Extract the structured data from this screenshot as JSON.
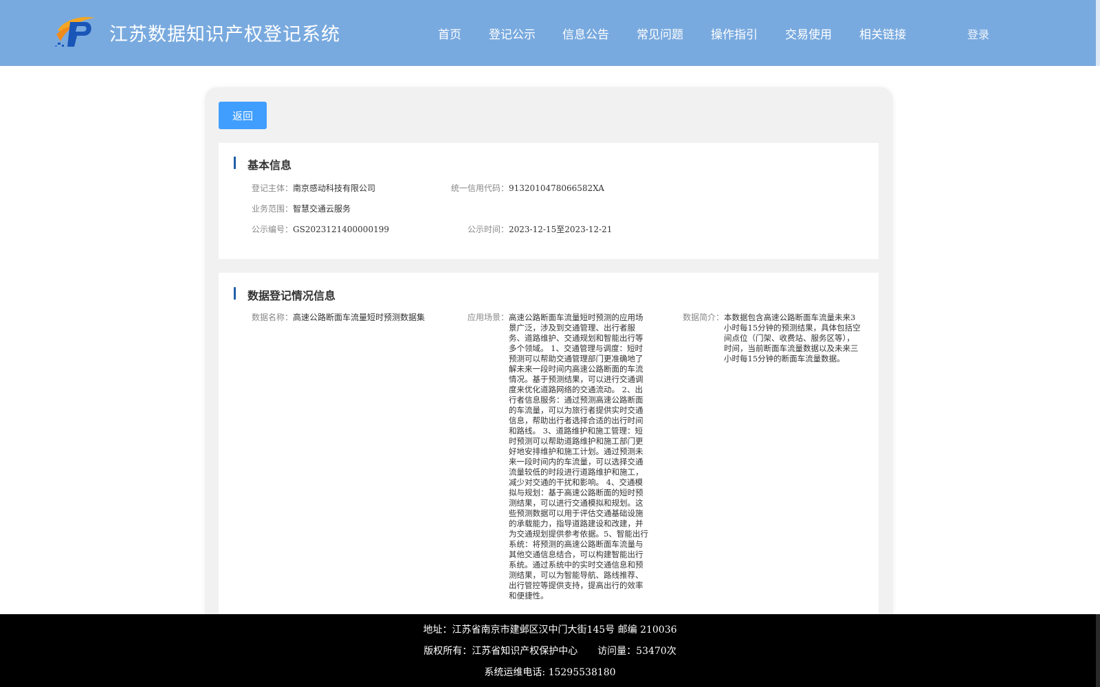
{
  "header": {
    "site_title": "江苏数据知识产权登记系统",
    "nav": [
      {
        "label": "首页"
      },
      {
        "label": "登记公示"
      },
      {
        "label": "信息公告"
      },
      {
        "label": "常见问题"
      },
      {
        "label": "操作指引"
      },
      {
        "label": "交易使用"
      },
      {
        "label": "相关链接"
      }
    ],
    "login_label": "登录",
    "logo_icon": "p-logo-icon",
    "colors": {
      "header_bg": "#79aadf",
      "primary_button": "#409eff",
      "section_marker": "#1f5fa8"
    }
  },
  "back_button_label": "返回",
  "basic_info": {
    "title": "基本信息",
    "subject_label": "登记主体：",
    "subject_value": "南京感动科技有限公司",
    "credit_code_label": "统一信用代码：",
    "credit_code_value": "9132010478066582XA",
    "business_scope_label": "业务范围：",
    "business_scope_value": "智慧交通云服务",
    "notice_no_label": "公示编号：",
    "notice_no_value": "GS2023121400000199",
    "notice_time_label": "公示时间：",
    "notice_time_value": "2023-12-15至2023-12-21"
  },
  "data_info": {
    "title": "数据登记情况信息",
    "name_label": "数据名称：",
    "name_value": "高速公路断面车流量短时预测数据集",
    "scenario_label": "应用场景：",
    "scenario_value": "高速公路断面车流量短时预测的应用场景广泛，涉及到交通管理、出行者服务、道路维护、交通规划和智能出行等多个领域。 1、交通管理与调度：短时预测可以帮助交通管理部门更准确地了解未来一段时间内高速公路断面的车流情况。基于预测结果，可以进行交通调度来优化道路网络的交通流动。 2、出行者信息服务：通过预测高速公路断面的车流量，可以为旅行者提供实时交通信息，帮助出行者选择合适的出行时间和路线。 3、道路维护和施工管理：短时预测可以帮助道路维护和施工部门更好地安排维护和施工计划。通过预测未来一段时间内的车流量，可以选择交通流量较低的时段进行道路维护和施工，减少对交通的干扰和影响。 4、交通模拟与规划：基于高速公路断面的短时预测结果，可以进行交通模拟和规划。这些预测数据可以用于评估交通基础设施的承载能力，指导道路建设和改建，并为交通规划提供参考依据。5、智能出行系统：将预测的高速公路断面车流量与其他交通信息结合，可以构建智能出行系统。通过系统中的实时交通信息和预测结果，可以为智能导航、路线推荐、出行管控等提供支持，提高出行的效率和便捷性。",
    "intro_label": "数据简介：",
    "intro_value": "本数据包含高速公路断面车流量未来3小时每15分钟的预测结果，具体包括空间点位（门架、收费站、服务区等），时间，当前断面车流量数据以及未来三小时每15分钟的断面车流量数据。"
  },
  "footer": {
    "address": "地址：江苏省南京市建邺区汉中门大街145号 邮编 210036",
    "copyright": "版权所有：江苏省知识产权保护中心",
    "visits": "访问量：53470次",
    "phone": "系统运维电话: 15295538180"
  }
}
